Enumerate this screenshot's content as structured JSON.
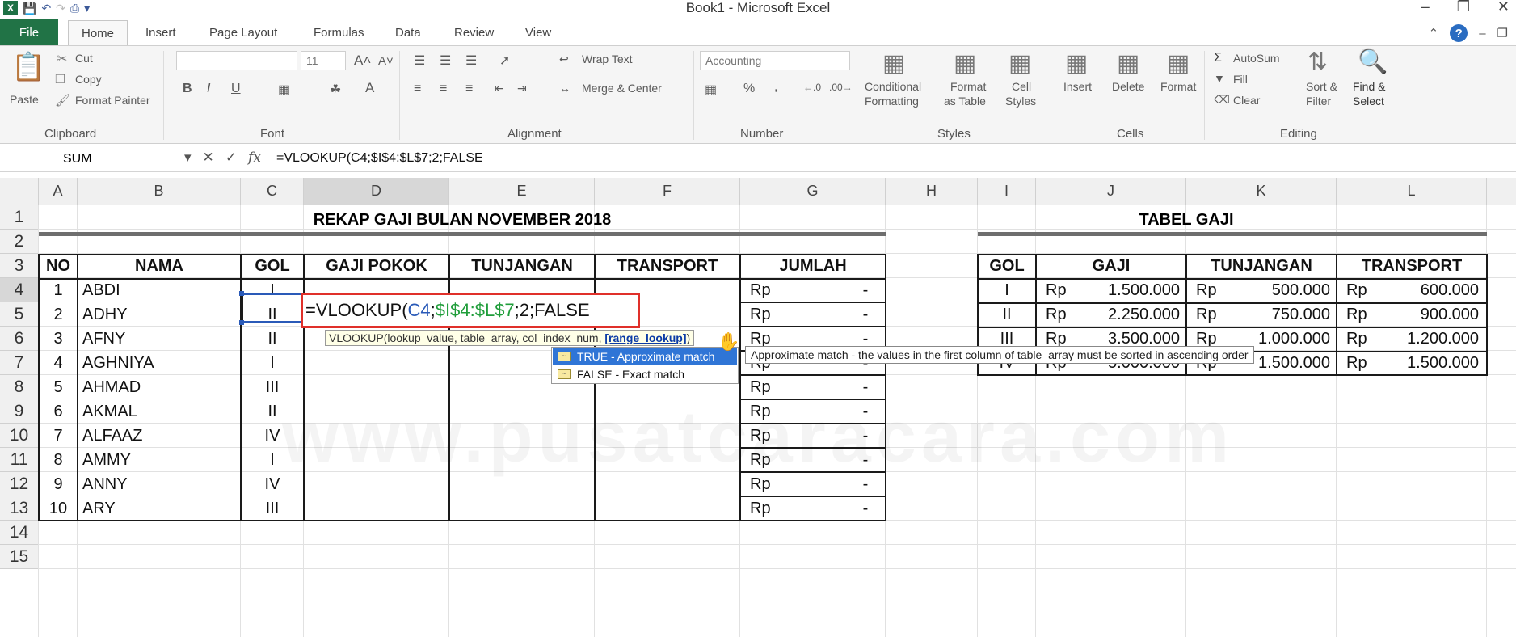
{
  "window": {
    "title": "Book1 - Microsoft Excel"
  },
  "tabs": {
    "file": "File",
    "home": "Home",
    "insert": "Insert",
    "page_layout": "Page Layout",
    "formulas": "Formulas",
    "data": "Data",
    "review": "Review",
    "view": "View"
  },
  "ribbon": {
    "clipboard": {
      "label": "Clipboard",
      "paste": "Paste",
      "cut": "Cut",
      "copy": "Copy",
      "format_painter": "Format Painter"
    },
    "font": {
      "label": "Font",
      "size": "11"
    },
    "alignment": {
      "label": "Alignment",
      "wrap_text": "Wrap Text",
      "merge_center": "Merge & Center"
    },
    "number": {
      "label": "Number",
      "format": "Accounting"
    },
    "styles": {
      "label": "Styles",
      "conditional_1": "Conditional",
      "conditional_2": "Formatting",
      "format_table_1": "Format",
      "format_table_2": "as Table",
      "cell_styles_1": "Cell",
      "cell_styles_2": "Styles"
    },
    "cells": {
      "label": "Cells",
      "insert": "Insert",
      "delete": "Delete",
      "format": "Format"
    },
    "editing": {
      "label": "Editing",
      "autosum": "AutoSum",
      "fill": "Fill",
      "clear": "Clear",
      "sort_1": "Sort &",
      "sort_2": "Filter",
      "find_1": "Find &",
      "find_2": "Select"
    }
  },
  "formula_bar": {
    "name_box": "SUM",
    "formula": "=VLOOKUP(C4;$I$4:$L$7;2;FALSE"
  },
  "columns": [
    "A",
    "B",
    "C",
    "D",
    "E",
    "F",
    "G",
    "H",
    "I",
    "J",
    "K",
    "L"
  ],
  "rows": [
    "1",
    "2",
    "3",
    "4",
    "5",
    "6",
    "7",
    "8",
    "9",
    "10",
    "11",
    "12",
    "13",
    "14",
    "15"
  ],
  "sheet": {
    "title1": "REKAP GAJI BULAN NOVEMBER 2018",
    "title2": "TABEL GAJI",
    "headers": [
      "NO",
      "NAMA",
      "GOL",
      "GAJI POKOK",
      "TUNJANGAN",
      "TRANSPORT",
      "JUMLAH"
    ],
    "records": [
      {
        "no": "1",
        "nama": "ABDI",
        "gol": "I"
      },
      {
        "no": "2",
        "nama": "ADHY",
        "gol": "II"
      },
      {
        "no": "3",
        "nama": "AFNY",
        "gol": "II"
      },
      {
        "no": "4",
        "nama": "AGHNIYA",
        "gol": "I"
      },
      {
        "no": "5",
        "nama": "AHMAD",
        "gol": "III"
      },
      {
        "no": "6",
        "nama": "AKMAL",
        "gol": "II"
      },
      {
        "no": "7",
        "nama": "ALFAAZ",
        "gol": "IV"
      },
      {
        "no": "8",
        "nama": "AMMY",
        "gol": "I"
      },
      {
        "no": "9",
        "nama": "ANNY",
        "gol": "IV"
      },
      {
        "no": "10",
        "nama": "ARY",
        "gol": "III"
      }
    ],
    "currency": "Rp",
    "dash": "-",
    "lookup_headers": [
      "GOL",
      "GAJI",
      "TUNJANGAN",
      "TRANSPORT"
    ],
    "lookup_rows": [
      {
        "gol": "I",
        "gaji": "1.500.000",
        "tunjangan": "500.000",
        "transport": "600.000"
      },
      {
        "gol": "II",
        "gaji": "2.250.000",
        "tunjangan": "750.000",
        "transport": "900.000"
      },
      {
        "gol": "III",
        "gaji": "3.500.000",
        "tunjangan": "1.000.000",
        "transport": "1.200.000"
      },
      {
        "gol": "IV",
        "gaji": "5.000.000",
        "tunjangan": "1.500.000",
        "transport": "1.500.000"
      }
    ]
  },
  "editing_cell": {
    "prefix": "=VLOOKUP(",
    "ref1": "C4",
    "sep1": ";",
    "ref2": "$I$4:$L$7",
    "suffix": ";2;FALSE"
  },
  "function_hint": {
    "text": "VLOOKUP(lookup_value, table_array, col_index_num, ",
    "current_arg": "[range_lookup]",
    "close": ")"
  },
  "autocomplete": [
    "TRUE - Approximate match",
    "FALSE - Exact match"
  ],
  "tooltip": "Approximate match - the values in the first column of table_array must be sorted in ascending order",
  "watermark": "www.pusatcaracara.com",
  "colors": {
    "file_tab": "#217346",
    "ref_c4": "#2a5ab8",
    "ref_range": "#1f9d3a",
    "highlight_box": "#e0302a",
    "selected_item": "#2f75d6"
  }
}
